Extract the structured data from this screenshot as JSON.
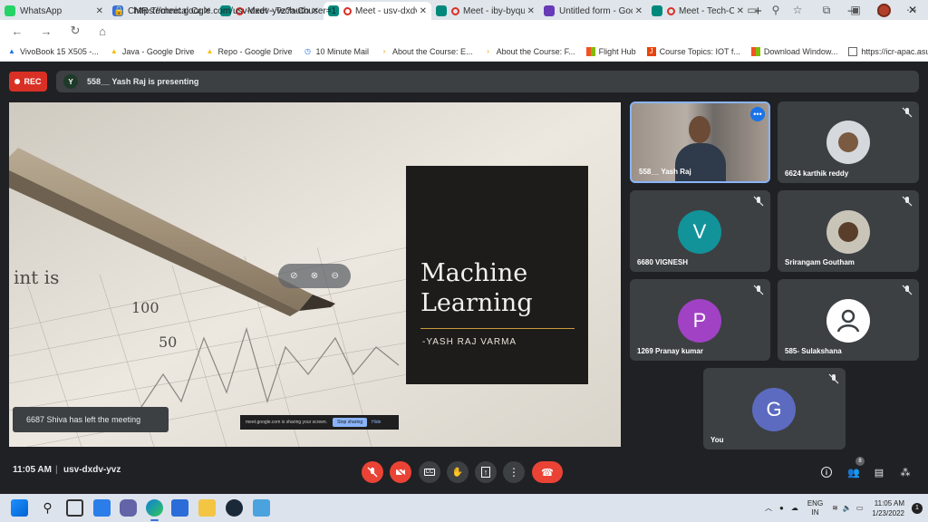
{
  "browser": {
    "tabs": [
      {
        "title": "WhatsApp",
        "icon": "whatsapp-icon",
        "color": "#25d366",
        "active": false,
        "recording": false
      },
      {
        "title": "CMR Technical Camp",
        "icon": "cmr-icon",
        "color": "#3b6fd6",
        "active": false,
        "recording": false
      },
      {
        "title": "Meet - Tech-Com",
        "icon": "meet-icon",
        "color": "#00897b",
        "active": false,
        "recording": true
      },
      {
        "title": "Meet - usv-dxdv",
        "icon": "meet-icon",
        "color": "#00897b",
        "active": true,
        "recording": true
      },
      {
        "title": "Meet - iby-byqu",
        "icon": "meet-icon",
        "color": "#00897b",
        "active": false,
        "recording": true
      },
      {
        "title": "Untitled form - Goog",
        "icon": "forms-icon",
        "color": "#673ab7",
        "active": false,
        "recording": false
      },
      {
        "title": "Meet - Tech-Com",
        "icon": "meet-icon",
        "color": "#00897b",
        "active": false,
        "recording": true
      }
    ],
    "url": "https://meet.google.com/usv-dxdv-yvz?authuser=1",
    "bookmarks": [
      {
        "label": "VivoBook 15 X505 -...",
        "icon": "asus-icon"
      },
      {
        "label": "Java - Google Drive",
        "icon": "drive-icon"
      },
      {
        "label": "Repo - Google Drive",
        "icon": "drive-icon"
      },
      {
        "label": "10 Minute Mail",
        "icon": "mail-icon"
      },
      {
        "label": "About the Course: E...",
        "icon": "chevron-icon"
      },
      {
        "label": "About the Course: F...",
        "icon": "chevron-icon"
      },
      {
        "label": "Flight Hub",
        "icon": "microsoft-icon"
      },
      {
        "label": "Course Topics: IOT f...",
        "icon": "j-icon"
      },
      {
        "label": "Download Window...",
        "icon": "microsoft-icon"
      },
      {
        "label": "https://icr-apac.asu...",
        "icon": "page-icon"
      }
    ]
  },
  "meet": {
    "rec_label": "REC",
    "presenter_initial": "Y",
    "presenter_text": "558__ Yash Raj is presenting",
    "slide": {
      "line1": "Machine",
      "line2": "Learning",
      "author": "-YASH RAJ VARMA",
      "sharing_text": "meet.google.com is sharing your screen.",
      "stop_label": "Stop sharing",
      "hide_label": "Hide"
    },
    "toast": "6687 Shiva has left the meeting",
    "participants": [
      {
        "name": "558__ Yash Raj",
        "type": "video",
        "muted": false
      },
      {
        "name": "6624 karthik reddy",
        "type": "photo",
        "muted": true
      },
      {
        "name": "6680 VIGNESH",
        "type": "initial",
        "initial": "V",
        "color": "#12939a",
        "muted": true
      },
      {
        "name": "Srirangam Goutham",
        "type": "photo",
        "muted": true
      },
      {
        "name": "1269 Pranay kumar",
        "type": "initial",
        "initial": "P",
        "color": "#a142c5",
        "muted": true
      },
      {
        "name": "585- Sulakshana",
        "type": "default",
        "muted": true
      },
      {
        "name": "You",
        "type": "initial",
        "initial": "G",
        "color": "#5c6bc0",
        "muted": true
      }
    ],
    "time": "11:05 AM",
    "separator": "|",
    "meeting_code": "usv-dxdv-yvz",
    "participant_count": "8"
  },
  "taskbar": {
    "lang_line1": "ENG",
    "lang_line2": "IN",
    "time": "11:05 AM",
    "date": "1/23/2022",
    "notification_count": "1"
  }
}
